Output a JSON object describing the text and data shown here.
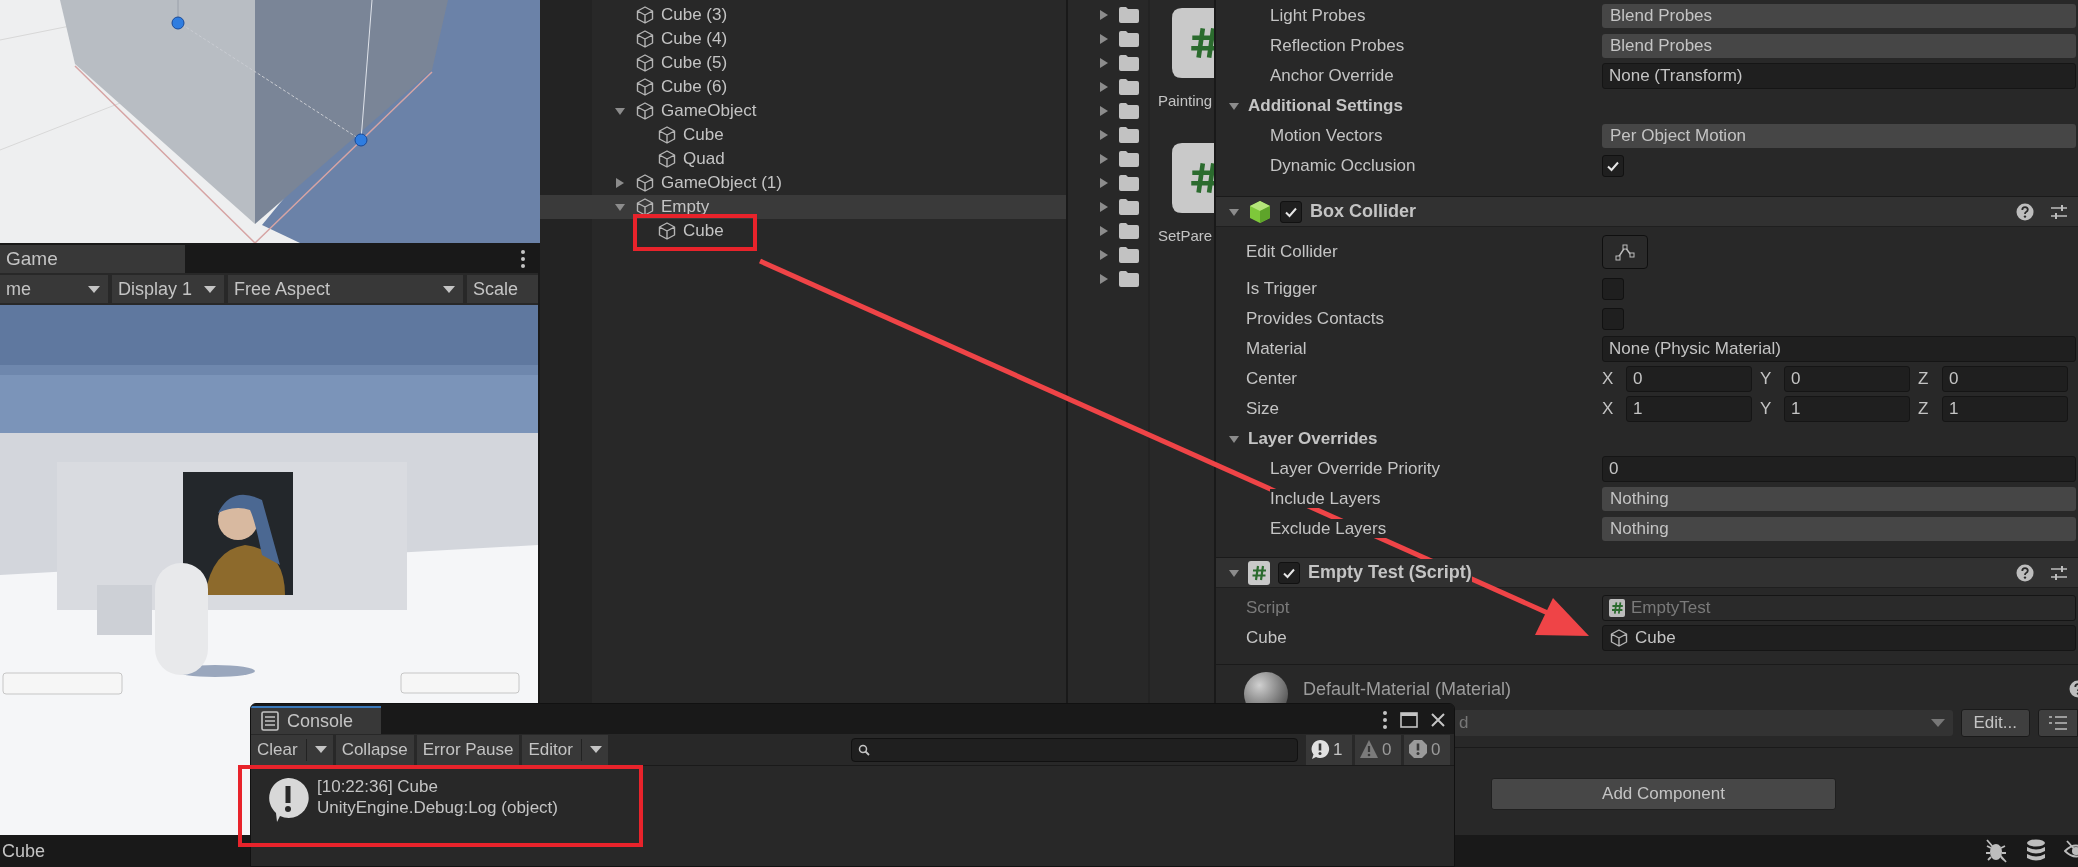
{
  "game_panel": {
    "tab": "Game",
    "toolbar": [
      {
        "kind": "dropdown",
        "label": "me"
      },
      {
        "kind": "dropdown",
        "label": "Display 1"
      },
      {
        "kind": "dropdown",
        "label": "Free Aspect"
      },
      {
        "kind": "label",
        "label": "Scale"
      }
    ]
  },
  "hierarchy": {
    "items": [
      {
        "label": "Cube (3)",
        "selected": false
      },
      {
        "label": "Cube (4)",
        "selected": false
      },
      {
        "label": "Cube (5)",
        "selected": false
      },
      {
        "label": "Cube (6)",
        "selected": false
      },
      {
        "label": "GameObject",
        "selected": false,
        "expanded": true,
        "children": [
          {
            "label": "Cube",
            "selected": false
          },
          {
            "label": "Quad",
            "selected": false
          }
        ]
      },
      {
        "label": "GameObject (1)",
        "selected": false,
        "expanded": false
      },
      {
        "label": "Empty",
        "selected": true,
        "expanded": true,
        "children": [
          {
            "label": "Cube",
            "selected": false
          }
        ]
      }
    ]
  },
  "project": {
    "folders": [
      {
        "expanded": false
      },
      {
        "expanded": false
      },
      {
        "expanded": false
      },
      {
        "expanded": false
      },
      {
        "expanded": false
      },
      {
        "expanded": false
      },
      {
        "expanded": false
      },
      {
        "expanded": false
      },
      {
        "expanded": false
      },
      {
        "expanded": false
      },
      {
        "expanded": false
      },
      {
        "expanded": false
      }
    ],
    "assets": [
      {
        "label": "Painting"
      },
      {
        "label": "SetPare"
      }
    ]
  },
  "inspector": {
    "components": [
      {
        "rows": [
          {
            "kind": "group",
            "children": [
              {
                "kind": "dropdown",
                "label": "Light Probes",
                "value": "Blend Probes"
              },
              {
                "kind": "dropdown",
                "label": "Reflection Probes",
                "value": "Blend Probes"
              },
              {
                "kind": "object",
                "label": "Anchor Override",
                "value": "None (Transform)"
              }
            ]
          },
          {
            "kind": "section",
            "label": "Additional Settings",
            "expanded": true,
            "children": [
              {
                "kind": "dropdown",
                "label": "Motion Vectors",
                "value": "Per Object Motion"
              },
              {
                "kind": "checkbox",
                "label": "Dynamic Occlusion",
                "checked": true
              }
            ]
          }
        ]
      },
      {
        "title": "Box Collider",
        "kind": "collider",
        "enabled": true,
        "expanded": true,
        "rows": [
          {
            "kind": "edit",
            "label": "Edit Collider"
          },
          {
            "kind": "checkbox",
            "label": "Is Trigger",
            "checked": false
          },
          {
            "kind": "checkbox",
            "label": "Provides Contacts",
            "checked": false
          },
          {
            "kind": "object",
            "label": "Material",
            "value": "None (Physic Material)"
          },
          {
            "kind": "vector",
            "label": "Center",
            "axes": [
              {
                "axis": "X",
                "value": "0"
              },
              {
                "axis": "Y",
                "value": "0"
              },
              {
                "axis": "Z",
                "value": "0"
              }
            ]
          },
          {
            "kind": "vector",
            "label": "Size",
            "axes": [
              {
                "axis": "X",
                "value": "1"
              },
              {
                "axis": "Y",
                "value": "1"
              },
              {
                "axis": "Z",
                "value": "1"
              }
            ]
          },
          {
            "kind": "section",
            "label": "Layer Overrides",
            "expanded": true,
            "children": [
              {
                "kind": "number",
                "label": "Layer Override Priority",
                "value": "0"
              },
              {
                "kind": "dropdown",
                "label": "Include Layers",
                "value": "Nothing"
              },
              {
                "kind": "dropdown",
                "label": "Exclude Layers",
                "value": "Nothing"
              }
            ]
          }
        ]
      },
      {
        "title": "Empty Test (Script)",
        "kind": "script",
        "enabled": true,
        "expanded": true,
        "rows": [
          {
            "kind": "script",
            "label": "Script",
            "value": "EmptyTest"
          },
          {
            "kind": "gameobject",
            "label": "Cube",
            "value": "Cube"
          }
        ]
      }
    ],
    "material": {
      "title": "Default-Material (Material)",
      "shader": "d",
      "edit_button": "Edit..."
    },
    "add_component": "Add Component"
  },
  "console": {
    "title": "Console",
    "toolbar": [
      {
        "label": "Clear",
        "dropdown": true
      },
      {
        "label": "Collapse",
        "dropdown": false
      },
      {
        "label": "Error Pause",
        "dropdown": false
      },
      {
        "label": "Editor",
        "dropdown": true
      }
    ],
    "counts": [
      {
        "kind": "info",
        "count": "1"
      },
      {
        "kind": "warning",
        "count": "0"
      },
      {
        "kind": "error",
        "count": "0"
      }
    ],
    "logs": [
      {
        "kind": "info",
        "message": "[10:22:36] Cube",
        "trace": "UnityEngine.Debug:Log (object)"
      }
    ]
  },
  "status_bar": {
    "text": "Cube"
  },
  "annotations": [
    {
      "kind": "box"
    },
    {
      "kind": "box"
    },
    {
      "kind": "arrow"
    }
  ]
}
